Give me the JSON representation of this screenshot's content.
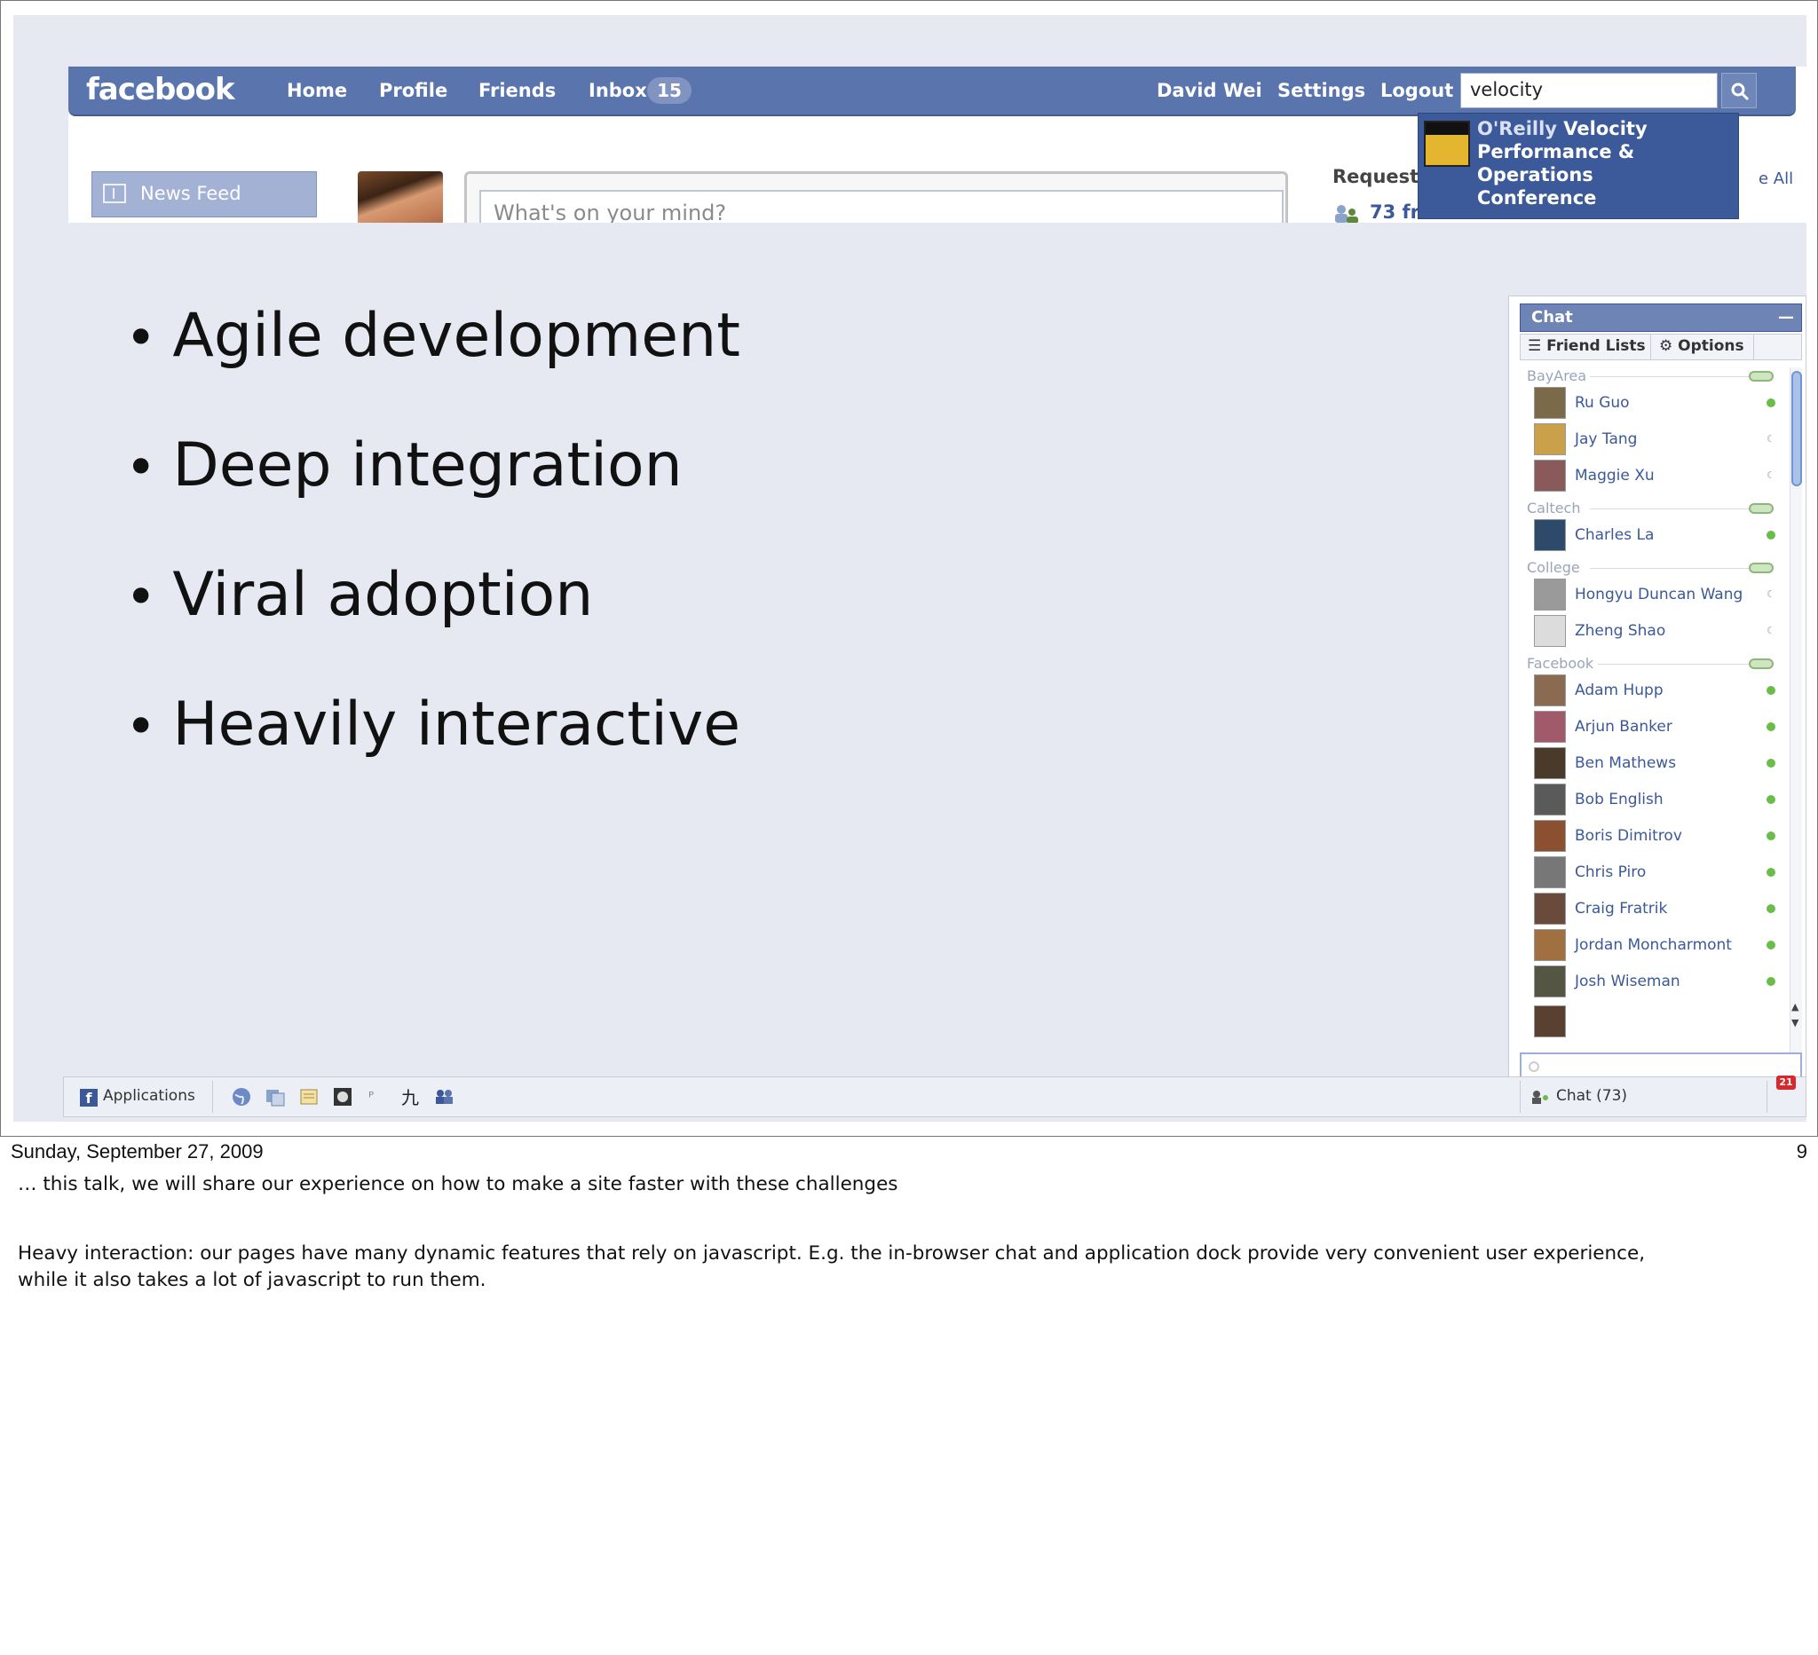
{
  "facebook": {
    "logo": "facebook",
    "nav": [
      "Home",
      "Profile",
      "Friends",
      "Inbox"
    ],
    "inbox_count": "15",
    "user_name": "David Wei",
    "settings": "Settings",
    "logout": "Logout",
    "search_value": "velocity",
    "dropdown": {
      "line1_prefix": "O'Reilly ",
      "line1_highlight": "Velocity",
      "line2": "Performance & Operations",
      "line3": "Conference"
    },
    "news_feed": "News Feed",
    "status_placeholder": "What's on your mind?",
    "requests_label": "Requests",
    "requests_count": "73 fr",
    "see_all": "e All"
  },
  "bullets": [
    "Agile development",
    "Deep integration",
    "Viral adoption",
    "Heavily interactive"
  ],
  "chat": {
    "title": "Chat",
    "tabs": [
      "Friend Lists",
      "Options"
    ],
    "groups": [
      {
        "name": "BayArea",
        "friends": [
          {
            "name": "Ru Guo",
            "status": "online"
          },
          {
            "name": "Jay Tang",
            "status": "idle"
          },
          {
            "name": "Maggie Xu",
            "status": "idle"
          }
        ]
      },
      {
        "name": "Caltech",
        "friends": [
          {
            "name": "Charles La",
            "status": "online"
          }
        ]
      },
      {
        "name": "College",
        "friends": [
          {
            "name": "Hongyu Duncan Wang",
            "status": "idle"
          },
          {
            "name": "Zheng Shao",
            "status": "idle"
          }
        ]
      },
      {
        "name": "Facebook",
        "friends": [
          {
            "name": "Adam Hupp",
            "status": "online"
          },
          {
            "name": "Arjun Banker",
            "status": "online"
          },
          {
            "name": "Ben Mathews",
            "status": "online"
          },
          {
            "name": "Bob English",
            "status": "online"
          },
          {
            "name": "Boris Dimitrov",
            "status": "online"
          },
          {
            "name": "Chris Piro",
            "status": "online"
          },
          {
            "name": "Craig Fratrik",
            "status": "online"
          },
          {
            "name": "Jordan Moncharmont",
            "status": "online"
          },
          {
            "name": "Josh Wiseman",
            "status": "online"
          }
        ]
      }
    ]
  },
  "dock": {
    "applications": "Applications",
    "chat_label": "Chat (73)",
    "notif_count": "21"
  },
  "footer": {
    "date": "Sunday, September 27, 2009",
    "slide_number": "9",
    "note_line1": "… this talk, we will share our experience on how to make a site faster with these challenges",
    "note_line2": "Heavy interaction: our pages have many dynamic features that rely on javascript. E.g. the in-browser chat  and application dock provide very convenient user experience,",
    "note_line3": "while it also takes a lot of javascript to run them."
  },
  "colors": {
    "fb_blue": "#5a75ad",
    "slide_bg": "#e6e9f2",
    "online_green": "#6bbd4a"
  }
}
